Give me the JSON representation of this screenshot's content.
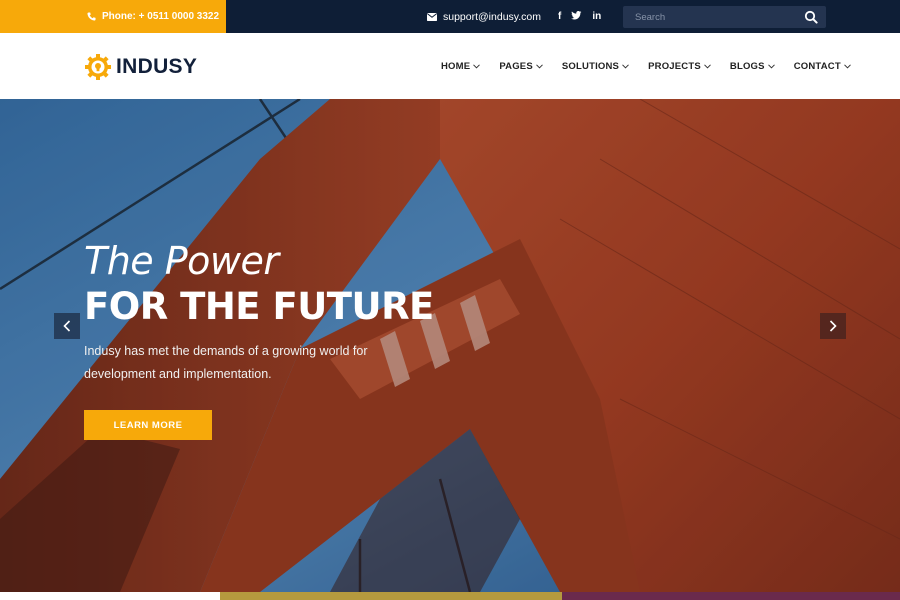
{
  "topbar": {
    "phone": "Phone: + 0511 0000 3322",
    "email": "support@indusy.com",
    "social": [
      "f",
      "t",
      "in"
    ],
    "search_placeholder": "Search"
  },
  "header": {
    "logo_text": "INDUSY",
    "nav": [
      "HOME",
      "PAGES",
      "SOLUTIONS",
      "PROJECTS",
      "BLOGS",
      "CONTACT"
    ]
  },
  "hero": {
    "line1": "The Power",
    "line2": "FOR THE FUTURE",
    "description": "Indusy has met the demands of a growing world for development and implementation.",
    "button": "LEARN MORE"
  },
  "colors": {
    "accent": "#f7a90a",
    "topbar_bg": "#0e1e36",
    "header_text": "#12203a"
  },
  "icons": {
    "phone": "phone-icon",
    "email": "envelope-icon",
    "search": "search-icon",
    "prev": "chevron-left-icon",
    "next": "chevron-right-icon"
  }
}
